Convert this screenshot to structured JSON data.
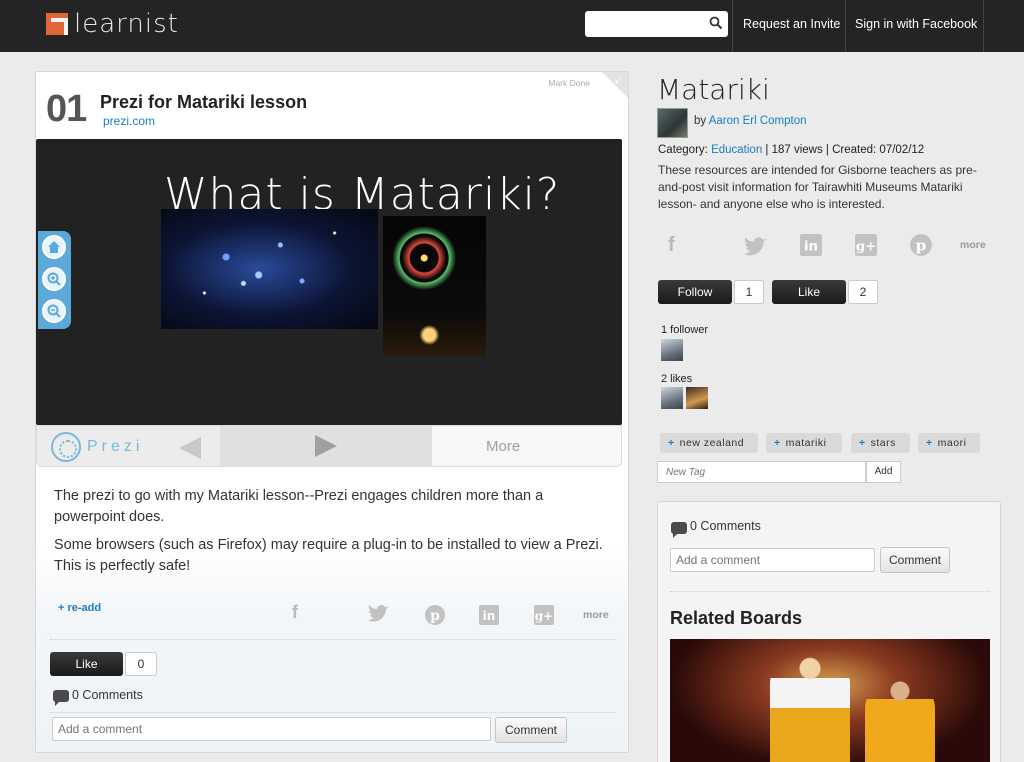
{
  "header": {
    "brand": "learnist",
    "search_placeholder": "",
    "request_invite": "Request an Invite",
    "sign_in": "Sign in with Facebook"
  },
  "item": {
    "mark_done": "Mark Done",
    "number": "01",
    "title": "Prezi for Matariki lesson",
    "source": "prezi.com",
    "viewer": {
      "heading": "What is Matariki?",
      "brand": "Prezi",
      "more": "More"
    },
    "description": [
      "The prezi to go with my Matariki lesson--Prezi engages children more than a powerpoint does.",
      "Some browsers (such as Firefox) may require a plug-in to be installed to view a Prezi. This is perfectly safe!"
    ],
    "readd": "+ re-add",
    "share_more": "more",
    "like_label": "Like",
    "like_count": "0",
    "comments": "0 Comments",
    "comment_placeholder": "Add a comment",
    "comment_button": "Comment"
  },
  "board": {
    "title": "Matariki",
    "by": "by",
    "author": "Aaron Erl Compton",
    "category_label": "Category:",
    "category": "Education",
    "stats": "| 187 views | Created: 07/02/12",
    "description": "These resources are intended for Gisborne teachers as pre-and-post visit information for Tairawhiti Museums Matariki lesson- and anyone else who is interested.",
    "share_more": "more",
    "follow_label": "Follow",
    "follow_count": "1",
    "like_label": "Like",
    "like_count": "2",
    "followers_label": "1 follower",
    "likes_label": "2 likes",
    "tags": [
      "new zealand",
      "matariki",
      "stars",
      "maori"
    ],
    "new_tag_placeholder": "New Tag",
    "add_label": "Add",
    "comments": "0 Comments",
    "comment_placeholder": "Add a comment",
    "comment_button": "Comment",
    "related_title": "Related Boards"
  }
}
